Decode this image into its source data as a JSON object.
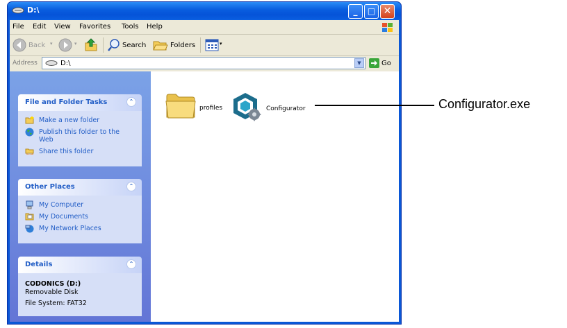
{
  "window": {
    "title": "D:\\",
    "buttons": {
      "minimize": "_",
      "maximize": "□",
      "close": "✕"
    }
  },
  "menu": [
    "File",
    "Edit",
    "View",
    "Favorites",
    "Tools",
    "Help"
  ],
  "toolbar": {
    "back": "Back",
    "search": "Search",
    "folders": "Folders"
  },
  "address": {
    "label": "Address",
    "value": "D:\\",
    "go": "Go"
  },
  "taskpane": {
    "file_tasks": {
      "title": "File and Folder Tasks",
      "items": [
        {
          "label": "Make a new folder",
          "icon": "new-folder-icon"
        },
        {
          "label": "Publish this folder to the Web",
          "icon": "publish-web-icon"
        },
        {
          "label": "Share this folder",
          "icon": "share-folder-icon"
        }
      ]
    },
    "other_places": {
      "title": "Other Places",
      "items": [
        {
          "label": "My Computer",
          "icon": "my-computer-icon"
        },
        {
          "label": "My Documents",
          "icon": "my-documents-icon"
        },
        {
          "label": "My Network Places",
          "icon": "network-places-icon"
        }
      ]
    },
    "details": {
      "title": "Details",
      "name": "CODONICS (D:)",
      "type": "Removable Disk",
      "filesystem": "File System: FAT32"
    }
  },
  "files": [
    {
      "name": "profiles",
      "icon": "folder-icon"
    },
    {
      "name": "Configurator",
      "icon": "configurator-app-icon"
    }
  ],
  "callout": {
    "text": "Configurator.exe"
  },
  "colors": {
    "titlebar": "#0a5fe0",
    "taskpane": "#6f8de0",
    "link": "#215dc6"
  }
}
